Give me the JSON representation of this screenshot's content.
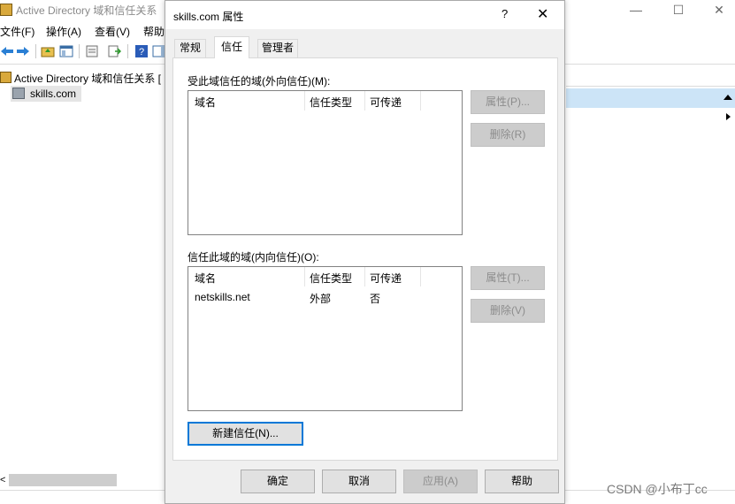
{
  "mmc": {
    "title": "Active Directory 域和信任关系",
    "menu": [
      "文件(F)",
      "操作(A)",
      "查看(V)",
      "帮助"
    ],
    "tree": {
      "root": "Active Directory 域和信任关系 [",
      "child": "skills.com"
    },
    "hscroll_left": "<",
    "window_controls": {
      "minimize": "—",
      "maximize": "☐",
      "close": "✕"
    }
  },
  "dialog": {
    "title": "skills.com 属性",
    "help_glyph": "?",
    "close_glyph": "✕",
    "tabs": [
      {
        "label": "常规",
        "active": false
      },
      {
        "label": "信任",
        "active": true
      },
      {
        "label": "管理者",
        "active": false
      }
    ],
    "outgoing": {
      "label": "受此域信任的域(外向信任)(M):",
      "columns": [
        "域名",
        "信任类型",
        "可传递"
      ],
      "rows": [],
      "buttons": {
        "properties": "属性(P)...",
        "remove": "删除(R)"
      }
    },
    "incoming": {
      "label": "信任此域的域(内向信任)(O):",
      "columns": [
        "域名",
        "信任类型",
        "可传递"
      ],
      "rows": [
        {
          "domain": "netskills.net",
          "type": "外部",
          "transitive": "否"
        }
      ],
      "buttons": {
        "properties": "属性(T)...",
        "remove": "删除(V)"
      }
    },
    "new_trust_label": "新建信任(N)...",
    "footer": {
      "ok": "确定",
      "cancel": "取消",
      "apply": "应用(A)",
      "help": "帮助"
    }
  },
  "watermark": "CSDN @小布丁cc"
}
